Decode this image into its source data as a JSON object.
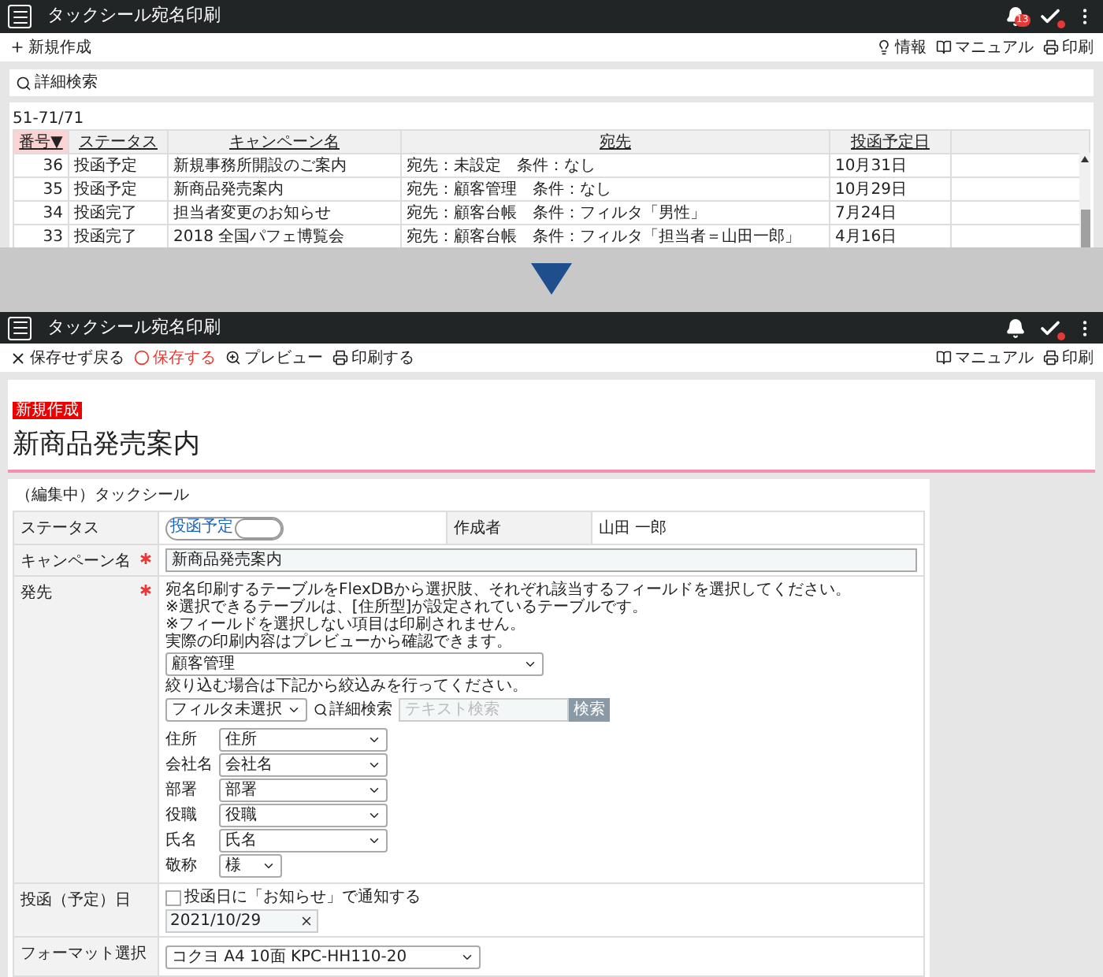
{
  "list_screen": {
    "header": {
      "title": "タックシール宛名印刷",
      "notification_count": "13"
    },
    "toolbar": {
      "new_button": "新規作成",
      "links": [
        {
          "kind": "info",
          "label": "情報"
        },
        {
          "kind": "manual",
          "label": "マニュアル"
        },
        {
          "kind": "print",
          "label": "印刷"
        }
      ]
    },
    "search": {
      "label": "詳細検索"
    },
    "count": "51-71/71",
    "table": {
      "columns": [
        {
          "label": "番号▼",
          "selected": true
        },
        {
          "label": "ステータス",
          "selected": false
        },
        {
          "label": "キャンペーン名",
          "selected": false
        },
        {
          "label": "宛先",
          "selected": false
        },
        {
          "label": "投函予定日",
          "selected": false
        }
      ],
      "rows": [
        [
          "36",
          "投函予定",
          "新規事務所開設のご案内",
          "宛先：未設定　条件：なし",
          "10月31日"
        ],
        [
          "35",
          "投函予定",
          "新商品発売案内",
          "宛先：顧客管理　条件：なし",
          "10月29日"
        ],
        [
          "34",
          "投函完了",
          "担当者変更のお知らせ",
          "宛先：顧客台帳　条件：フィルタ「男性」",
          "7月24日"
        ],
        [
          "33",
          "投函完了",
          "2018 全国パフェ博覧会",
          "宛先：顧客台帳　条件：フィルタ「担当者＝山田一郎」",
          "4月16日"
        ]
      ]
    }
  },
  "edit_screen": {
    "header": {
      "title": "タックシール宛名印刷"
    },
    "toolbar": {
      "actions": [
        {
          "kind": "cancel",
          "label": "保存せず戻る"
        },
        {
          "kind": "save",
          "label": "保存する"
        },
        {
          "kind": "preview",
          "label": "プレビュー"
        },
        {
          "kind": "print",
          "label": "印刷する"
        }
      ],
      "links": [
        {
          "kind": "manual",
          "label": "マニュアル"
        },
        {
          "kind": "print",
          "label": "印刷"
        }
      ]
    },
    "title_card": {
      "tag": "新規作成",
      "heading": "新商品発売案内"
    },
    "form": {
      "section_title": "（編集中）タックシール",
      "status": {
        "label": "ステータス",
        "toggle_label": "投函予定",
        "on": false,
        "author_label": "作成者",
        "author": "山田 一郎"
      },
      "campaign": {
        "label": "キャンペーン名",
        "required": true,
        "value": "新商品発売案内"
      },
      "destination": {
        "label": "発先",
        "required": true,
        "notes": [
          "宛名印刷するテーブルをFlexDBから選択肢、それぞれ該当するフィールドを選択してください。",
          "※選択できるテーブルは、[住所型]が設定されているテーブルです。",
          "※フィールドを選択しない項目は印刷されません。",
          "実際の印刷内容はプレビューから確認できます。"
        ],
        "table_select": "顧客管理",
        "filter_hint": "絞り込む場合は下記から絞込みを行ってください。",
        "filter_select": "フィルタ未選択",
        "advanced_search": "詳細検索",
        "search_placeholder": "テキスト検索",
        "search_button": "検索",
        "fields": [
          {
            "label": "住所",
            "value": "住所"
          },
          {
            "label": "会社名",
            "value": "会社名"
          },
          {
            "label": "部署",
            "value": "部署"
          },
          {
            "label": "役職",
            "value": "役職"
          },
          {
            "label": "氏名",
            "value": "氏名"
          },
          {
            "label": "敬称",
            "value": "様"
          }
        ]
      },
      "date": {
        "label": "投函（予定）日",
        "notify_label": "投函日に「お知らせ」で通知する",
        "notify": false,
        "value": "2021/10/29"
      },
      "format": {
        "label": "フォーマット選択",
        "value": "コクヨ A4 10面 KPC-HH110-20"
      }
    }
  }
}
